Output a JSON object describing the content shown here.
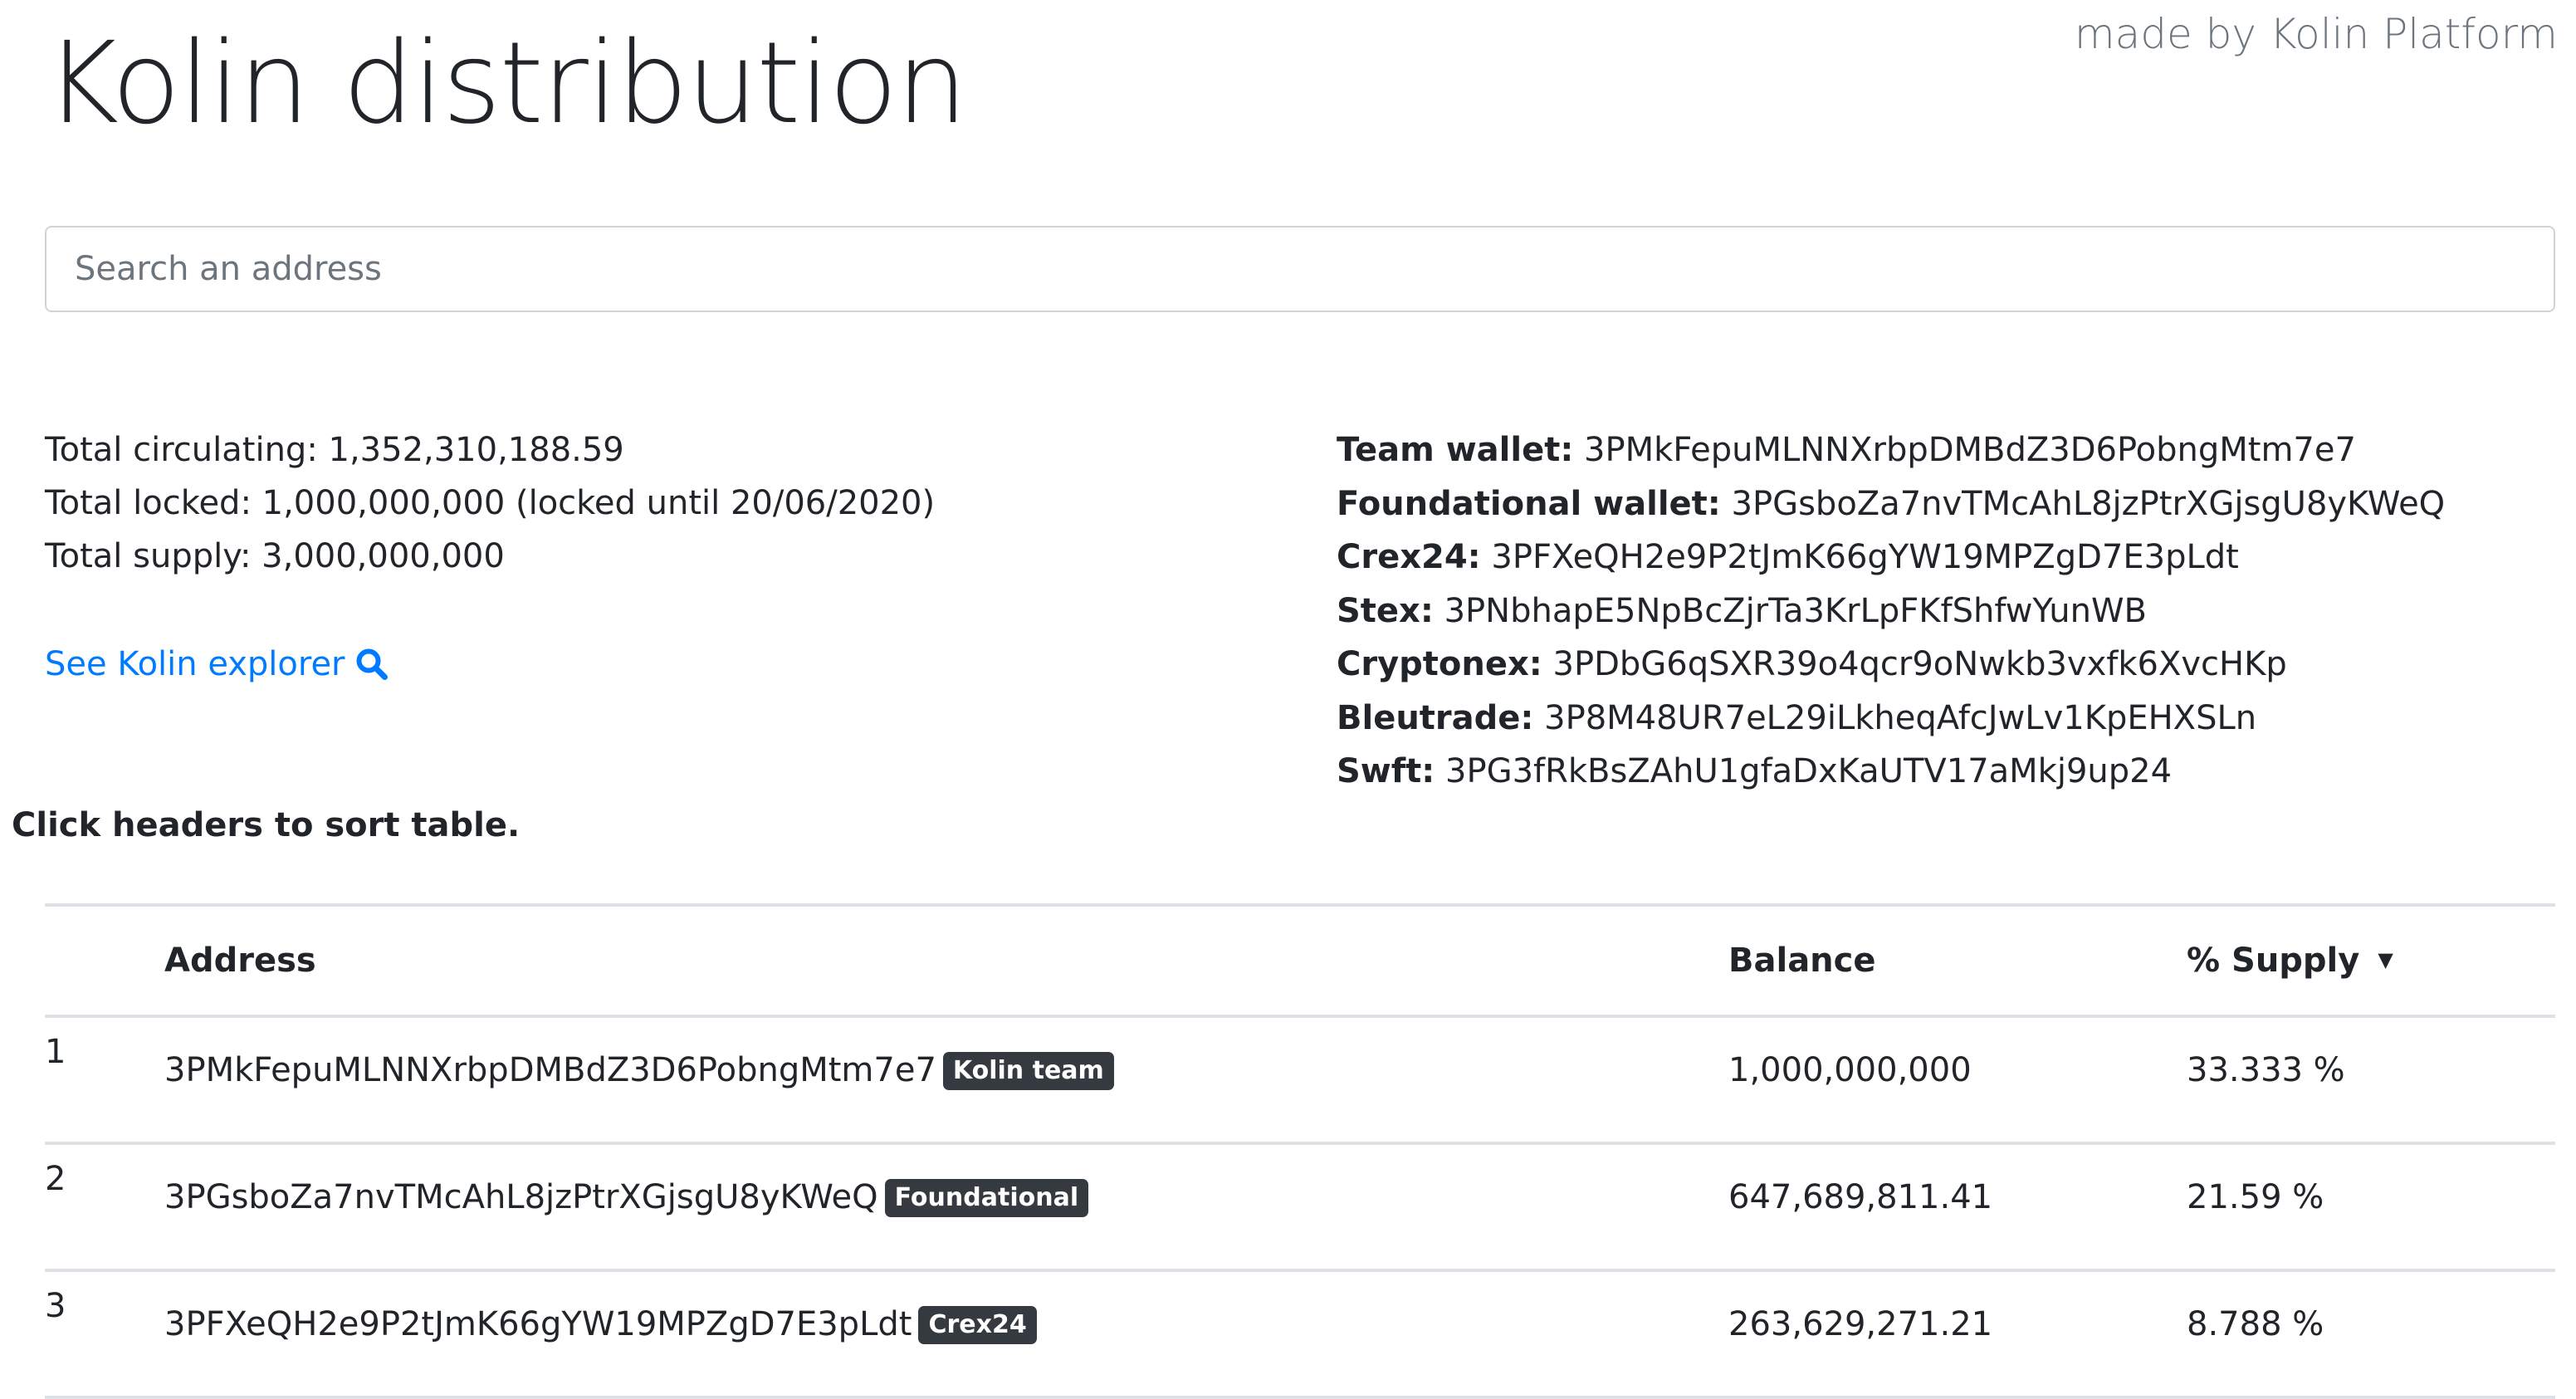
{
  "header": {
    "title": "Kolin distribution",
    "credit": "made by Kolin Platform"
  },
  "search": {
    "placeholder": "Search an address",
    "value": ""
  },
  "totals": {
    "circulating": "Total circulating: 1,352,310,188.59",
    "locked": "Total locked: 1,000,000,000 (locked until 20/06/2020)",
    "supply": "Total supply: 3,000,000,000"
  },
  "explorer_link": {
    "label": "See Kolin explorer",
    "icon": "search-icon"
  },
  "wallets": [
    {
      "label": "Team wallet:",
      "address": "3PMkFepuMLNNXrbpDMBdZ3D6PobngMtm7e7"
    },
    {
      "label": "Foundational wallet:",
      "address": "3PGsboZa7nvTMcAhL8jzPtrXGjsgU8yKWeQ"
    },
    {
      "label": "Crex24:",
      "address": "3PFXeQH2e9P2tJmK66gYW19MPZgD7E3pLdt"
    },
    {
      "label": "Stex:",
      "address": "3PNbhapE5NpBcZjrTa3KrLpFKfShfwYunWB"
    },
    {
      "label": "Cryptonex:",
      "address": "3PDbG6qSXR39o4qcr9oNwkb3vxfk6XvcHKp"
    },
    {
      "label": "Bleutrade:",
      "address": "3P8M48UR7eL29iLkheqAfcJwLv1KpEHXSLn"
    },
    {
      "label": "Swft:",
      "address": "3PG3fRkBsZAhU1gfaDxKaUTV17aMkj9up24"
    }
  ],
  "sort_hint": "Click headers to sort table.",
  "table": {
    "columns": {
      "rank": "",
      "address": "Address",
      "balance": "Balance",
      "supply": "% Supply",
      "supply_sort_indicator": "▼"
    },
    "rows": [
      {
        "rank": "1",
        "address": "3PMkFepuMLNNXrbpDMBdZ3D6PobngMtm7e7",
        "tag": "Kolin team",
        "balance": "1,000,000,000",
        "supply": "33.333 %"
      },
      {
        "rank": "2",
        "address": "3PGsboZa7nvTMcAhL8jzPtrXGjsgU8yKWeQ",
        "tag": "Foundational",
        "balance": "647,689,811.41",
        "supply": "21.59 %"
      },
      {
        "rank": "3",
        "address": "3PFXeQH2e9P2tJmK66gYW19MPZgD7E3pLdt",
        "tag": "Crex24",
        "balance": "263,629,271.21",
        "supply": "8.788 %"
      }
    ]
  },
  "colors": {
    "text": "#212529",
    "link": "#007bff",
    "badge_bg": "#343a40",
    "border": "#dee2e6",
    "muted": "#6c757d"
  }
}
